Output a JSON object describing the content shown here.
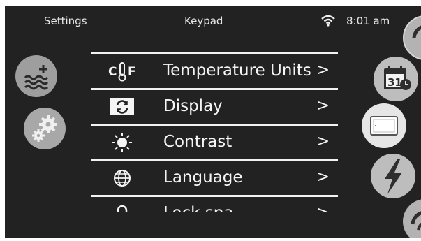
{
  "status_bar": {
    "left_label": "Settings",
    "center_label": "Keypad",
    "time": "8:01 am",
    "wifi_icon": "wifi-icon"
  },
  "menu": {
    "items": [
      {
        "label": "Temperature Units",
        "arrow": ">",
        "icon": "celsius-fahrenheit-icon",
        "icon_text": "C|F"
      },
      {
        "label": "Display",
        "arrow": ">",
        "icon": "refresh-icon"
      },
      {
        "label": "Contrast",
        "arrow": ">",
        "icon": "sun-icon"
      },
      {
        "label": "Language",
        "arrow": ">",
        "icon": "globe-icon"
      },
      {
        "label": "Lock spa",
        "arrow": ">",
        "icon": "lock-icon"
      }
    ]
  },
  "side_buttons": {
    "left": [
      "water-heat-icon",
      "gears-icon"
    ],
    "right": [
      "partial-top-icon",
      "calendar-icon",
      "panel-icon",
      "lightning-icon",
      "partial-bottom-icon"
    ]
  },
  "calendar_day": "31",
  "colors": {
    "screen_bg": "#222222",
    "text": "#f4f4f4",
    "button_gray": "#bdbdbd"
  }
}
